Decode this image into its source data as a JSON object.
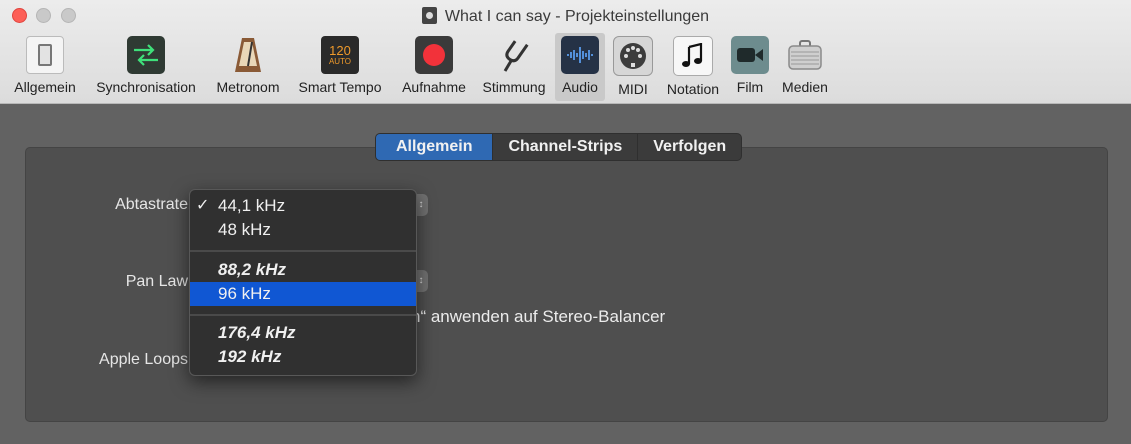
{
  "window": {
    "title": "What I can say - Projekteinstellungen"
  },
  "toolbar": {
    "items": [
      {
        "label": "Allgemein",
        "icon": "switch-icon"
      },
      {
        "label": "Synchronisation",
        "icon": "sync-arrows-icon"
      },
      {
        "label": "Metronom",
        "icon": "metronome-icon"
      },
      {
        "label": "Smart Tempo",
        "icon": "smart-tempo-icon",
        "icon_text_top": "120",
        "icon_text_bottom": "AUTO"
      },
      {
        "label": "Aufnahme",
        "icon": "record-icon"
      },
      {
        "label": "Stimmung",
        "icon": "tuning-fork-icon"
      },
      {
        "label": "Audio",
        "icon": "waveform-icon",
        "active": true
      },
      {
        "label": "MIDI",
        "icon": "midi-connector-icon"
      },
      {
        "label": "Notation",
        "icon": "music-note-icon"
      },
      {
        "label": "Film",
        "icon": "video-camera-icon"
      },
      {
        "label": "Medien",
        "icon": "briefcase-icon"
      }
    ]
  },
  "tabs": [
    {
      "label": "Allgemein",
      "selected": true
    },
    {
      "label": "Channel-Strips",
      "selected": false
    },
    {
      "label": "Verfolgen",
      "selected": false
    }
  ],
  "settings": {
    "sample_rate_label": "Abtastrate",
    "pan_law_label": "Pan Law",
    "pan_law_checkbox_suffix": "n“ anwenden auf Stereo-Balancer",
    "apple_loops_label": "Apple Loops"
  },
  "sample_rate_menu": {
    "groups": [
      [
        {
          "label": "44,1 kHz",
          "checked": true,
          "italic": false,
          "highlighted": false
        },
        {
          "label": "48 kHz",
          "checked": false,
          "italic": false,
          "highlighted": false
        }
      ],
      [
        {
          "label": "88,2 kHz",
          "checked": false,
          "italic": true,
          "highlighted": false
        },
        {
          "label": "96 kHz",
          "checked": false,
          "italic": false,
          "highlighted": true
        }
      ],
      [
        {
          "label": "176,4 kHz",
          "checked": false,
          "italic": true,
          "highlighted": false
        },
        {
          "label": "192 kHz",
          "checked": false,
          "italic": true,
          "highlighted": false
        }
      ]
    ],
    "check_glyph": "✓"
  },
  "colors": {
    "selected_tab": "#2f69b3",
    "menu_highlight": "#1057d3",
    "close_button": "#fd5f57"
  }
}
